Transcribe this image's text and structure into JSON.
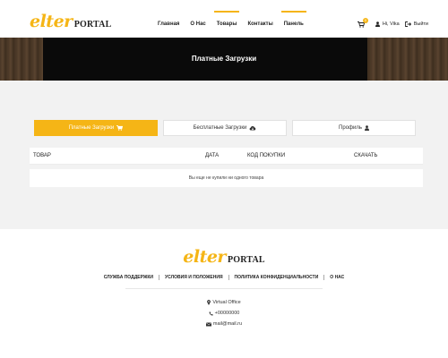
{
  "header": {
    "logo": {
      "elter": "elter",
      "portal": "PORTAL"
    },
    "nav": [
      {
        "label": "Главная",
        "active": false
      },
      {
        "label": "О Нас",
        "active": false
      },
      {
        "label": "Товары",
        "active": true
      },
      {
        "label": "Контакты",
        "active": false
      },
      {
        "label": "Панель",
        "active": true
      }
    ],
    "cart_count": "0",
    "user_label": "Hi, Vika",
    "logout_label": "Выйти"
  },
  "banner": {
    "title": "Платные Загрузки"
  },
  "tabs": [
    {
      "label": "Платные Загрузки",
      "icon": "cart-icon",
      "active": true
    },
    {
      "label": "Бесплатные Загрузки",
      "icon": "cloud-download-icon",
      "active": false
    },
    {
      "label": "Профиль",
      "icon": "user-icon",
      "active": false
    }
  ],
  "table": {
    "columns": [
      "ТОВАР",
      "ДАТА",
      "КОД ПОКУПКИ",
      "СКАЧАТЬ"
    ],
    "empty_message": "Вы еще не купили ни одного товара"
  },
  "footer": {
    "logo": {
      "elter": "elter",
      "portal": "PORTAL"
    },
    "links": [
      "СЛУЖБА ПОДДЕРЖКИ",
      "УСЛОВИЯ И ПОЛОЖЕНИЯ",
      "ПОЛИТИКА КОНФИДЕНЦИАЛЬНОСТИ",
      "О НАС"
    ],
    "address": "Virtual Office",
    "phone": "+00000000",
    "email": "mail@mail.ru"
  },
  "colors": {
    "accent": "#f5b516",
    "text": "#222222",
    "background": "#f2f2f2"
  }
}
